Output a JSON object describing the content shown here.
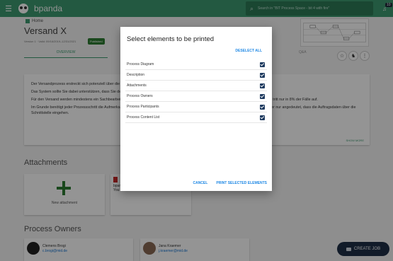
{
  "app": {
    "name": "bpanda"
  },
  "header": {
    "search_placeholder": "Search in \"BIT Process Space - bit 4 with fire\"",
    "notification_count": "10"
  },
  "breadcrumb": {
    "label": "Home"
  },
  "process": {
    "title": "Versand X",
    "version": "Version 1 · Valid: 09/16/2019–12/31/2021",
    "status": "Published"
  },
  "tabs": [
    {
      "label": "OVERVIEW"
    },
    {
      "label": "Q&A"
    }
  ],
  "description": {
    "lines": [
      "Der Versandprozess erstreckt sich potenziell über die ganze Organisation und es können in der Regel viele, oft parallel laufende Schritte enthält.",
      "Das System sollte Sie dabei unterstützen, dass Sie den Überblick behalten.",
      "Für den Versand werden mindestens ein Sachbearbeiter und die Logistik benötigt. Wenn die Ware nicht rechtzeitig abgeschlossen werden muss, tritt nur in 8% der Fälle auf.",
      "Im Grunde benötigt jeder Prozessschritt die Aufmerksamkeit der jeweils zuständigen Mitarbeiter. Die Verständlichkeit des Prozesses: Daher ist hier nur angedeutet, dass die Auftragsdaten über die Schnittstelle eingehen."
    ],
    "show_more": "SHOW MORE"
  },
  "attachments": {
    "title": "Attachments",
    "new_label": "New attachment",
    "file_name": "bpan",
    "file_meta": "You and Me"
  },
  "owners": {
    "title": "Process Owners",
    "items": [
      {
        "name": "Clemens Brogi",
        "email": "c.brogi@mid.de"
      },
      {
        "name": "Jana Kraemer",
        "email": "j.kraemer@mid.de"
      }
    ]
  },
  "create_job": {
    "label": "CREATE JOB"
  },
  "dialog": {
    "title": "Select elements to be printed",
    "deselect_all": "DESELECT ALL",
    "items": [
      {
        "label": "Process Diagram",
        "checked": true
      },
      {
        "label": "Description",
        "checked": true
      },
      {
        "label": "Attachments",
        "checked": true
      },
      {
        "label": "Process Owners",
        "checked": true
      },
      {
        "label": "Process Participants",
        "checked": true
      },
      {
        "label": "Process Content List",
        "checked": true
      }
    ],
    "cancel": "CANCEL",
    "print": "PRINT SELECTED ELEMENTS"
  },
  "colors": {
    "brand": "#3d9970",
    "checkbox": "#1e3a5f",
    "action": "#1e88e5"
  }
}
